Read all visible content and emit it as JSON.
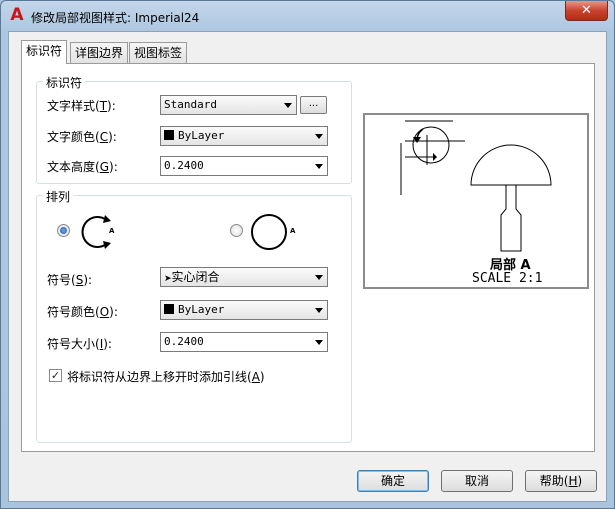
{
  "window": {
    "title": "修改局部视图样式: Imperial24",
    "app_logo_glyph": "A",
    "close_glyph": "✕"
  },
  "tabs": [
    {
      "label": "标识符",
      "active": true
    },
    {
      "label": "详图边界",
      "active": false
    },
    {
      "label": "视图标签",
      "active": false
    }
  ],
  "identifier": {
    "group_label": "标识符",
    "text_style": {
      "label": "文字样式",
      "key": "T",
      "value": "Standard",
      "browse_label": "..."
    },
    "text_color": {
      "label": "文字颜色",
      "key": "C",
      "value": "ByLayer"
    },
    "text_height": {
      "label": "文本高度",
      "key": "G",
      "value": "0.2400"
    }
  },
  "arrangement": {
    "group_label": "排列",
    "radio1_letter": "A",
    "radio2_letter": "A",
    "symbol": {
      "label": "符号",
      "key": "S",
      "value": "实心闭合"
    },
    "symbol_color": {
      "label": "符号颜色",
      "key": "O",
      "value": "ByLayer"
    },
    "symbol_size": {
      "label": "符号大小",
      "key": "I",
      "value": "0.2400"
    },
    "leader_checkbox": {
      "label": "将标识符从边界上移开时添加引线",
      "key": "A",
      "checked": true
    }
  },
  "preview": {
    "caption": "局部 A",
    "scale": "SCALE 2:1"
  },
  "buttons": {
    "ok": "确定",
    "cancel": "取消",
    "help": "帮助",
    "help_key": "H"
  },
  "colors": {
    "accent": "#1d5aa8",
    "close": "#c8442e",
    "logo": "#c8141c"
  }
}
